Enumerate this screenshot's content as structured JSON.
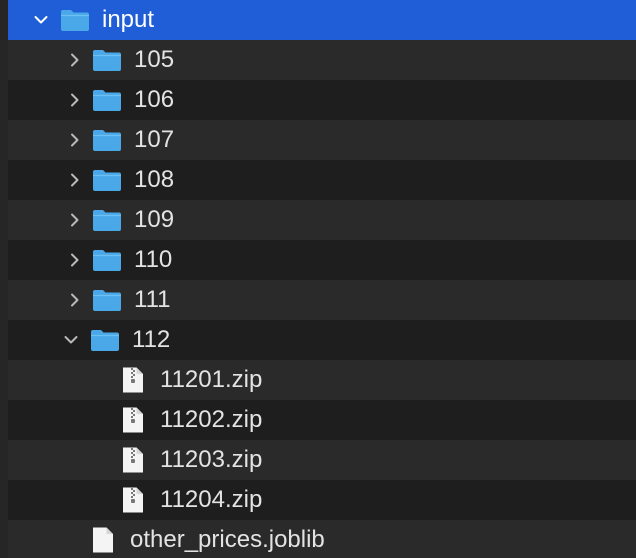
{
  "tree": {
    "root": {
      "label": "input",
      "expanded": true,
      "selected": true
    },
    "folders": [
      {
        "label": "105",
        "expanded": false
      },
      {
        "label": "106",
        "expanded": false
      },
      {
        "label": "107",
        "expanded": false
      },
      {
        "label": "108",
        "expanded": false
      },
      {
        "label": "109",
        "expanded": false
      },
      {
        "label": "110",
        "expanded": false
      },
      {
        "label": "111",
        "expanded": false
      },
      {
        "label": "112",
        "expanded": true
      }
    ],
    "files_in_112": [
      {
        "label": "11201.zip",
        "icon": "zip-file-icon"
      },
      {
        "label": "11202.zip",
        "icon": "zip-file-icon"
      },
      {
        "label": "11203.zip",
        "icon": "zip-file-icon"
      },
      {
        "label": "11204.zip",
        "icon": "zip-file-icon"
      }
    ],
    "root_files": [
      {
        "label": "other_prices.joblib",
        "icon": "document-icon"
      }
    ]
  },
  "colors": {
    "selection": "#1f5ed6",
    "folder": "#4aa8e8",
    "text": "#e3e3e3",
    "row_alt": "#2a2a2a",
    "row_base": "#1e1e1e"
  }
}
